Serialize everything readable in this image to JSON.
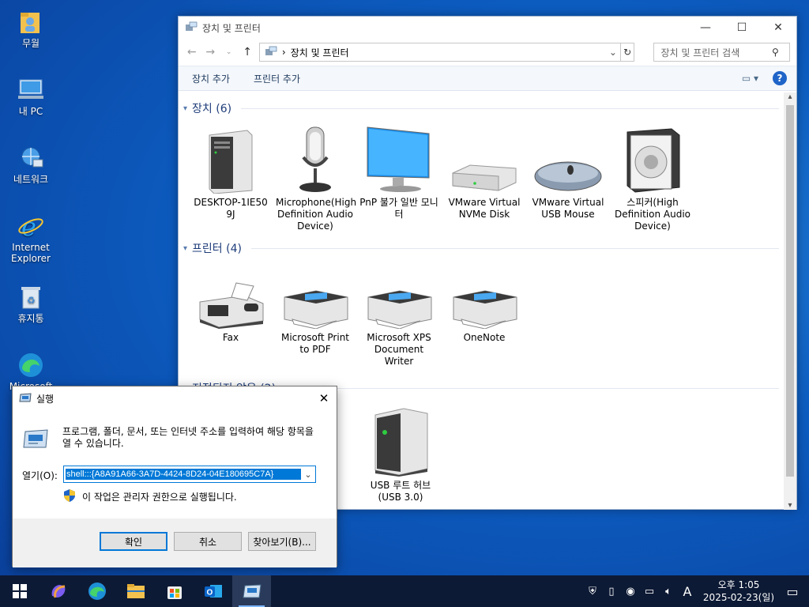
{
  "desktop": {
    "icons": [
      {
        "label": "무월"
      },
      {
        "label": "내 PC"
      },
      {
        "label": "네트워크"
      },
      {
        "label": "Internet Explorer"
      },
      {
        "label": "휴지통"
      },
      {
        "label": "Microsoft"
      }
    ]
  },
  "explorer": {
    "title": "장치 및 프린터",
    "address": "장치 및 프린터",
    "search_placeholder": "장치 및 프린터 검색",
    "toolbar": {
      "add_device": "장치 추가",
      "add_printer": "프린터 추가"
    },
    "groups": [
      {
        "header": "장치 (6)",
        "items": [
          {
            "label": "DESKTOP-1IE509J",
            "icon": "computer-tower-icon"
          },
          {
            "label": "Microphone(High Definition Audio Device)",
            "icon": "microphone-icon"
          },
          {
            "label": "PnP 불가 일반 모니터",
            "icon": "monitor-icon"
          },
          {
            "label": "VMware Virtual NVMe Disk",
            "icon": "disk-drive-icon"
          },
          {
            "label": "VMware Virtual USB Mouse",
            "icon": "mouse-icon"
          },
          {
            "label": "스피커(High Definition Audio Device)",
            "icon": "speaker-icon"
          }
        ]
      },
      {
        "header": "프린터 (4)",
        "items": [
          {
            "label": "Fax",
            "icon": "fax-icon"
          },
          {
            "label": "Microsoft Print to PDF",
            "icon": "printer-icon"
          },
          {
            "label": "Microsoft XPS Document Writer",
            "icon": "printer-icon"
          },
          {
            "label": "OneNote",
            "icon": "printer-icon"
          }
        ]
      },
      {
        "header": "지정되지 않음 (2)",
        "items": [
          {
            "label": "USB 루트 허브 (USB 3.0)",
            "icon": "usb-hub-icon"
          }
        ]
      }
    ]
  },
  "run_dialog": {
    "title": "실행",
    "description": "프로그램, 폴더, 문서, 또는 인터넷 주소를 입력하여 해당 항목을 열 수 있습니다.",
    "open_label": "열기(O):",
    "open_value": "shell:::{A8A91A66-3A7D-4424-8D24-04E180695C7A}",
    "admin_note": "이 작업은 관리자 권한으로 실행됩니다.",
    "ok": "확인",
    "cancel": "취소",
    "browse": "찾아보기(B)..."
  },
  "taskbar": {
    "time": "오후 1:05",
    "date": "2025-02-23(일)",
    "ime": "A"
  },
  "colors": {
    "accent": "#0078d7",
    "taskbar": "#0d1a35",
    "desktop": "#0c5cc0"
  }
}
